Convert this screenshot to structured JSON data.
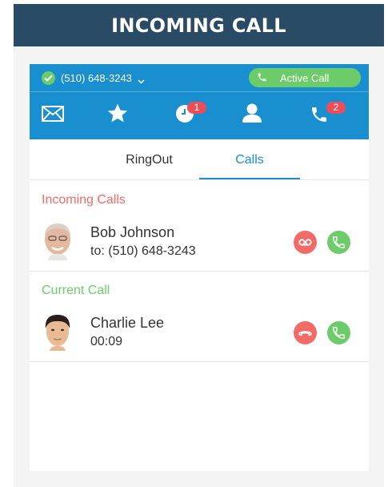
{
  "banner": {
    "title": "INCOMING CALL"
  },
  "topbar": {
    "phone_number": "(510) 648-3243",
    "active_call_label": "Active Call",
    "nav": [
      {
        "id": "messages",
        "icon": "envelope-icon",
        "badge": ""
      },
      {
        "id": "favorites",
        "icon": "star-icon",
        "badge": ""
      },
      {
        "id": "history",
        "icon": "clock-icon",
        "badge": "1"
      },
      {
        "id": "contacts",
        "icon": "person-icon",
        "badge": ""
      },
      {
        "id": "dialer",
        "icon": "phone-icon",
        "badge": "2"
      }
    ]
  },
  "tabs": {
    "ringout": "RingOut",
    "calls": "Calls",
    "active": "calls"
  },
  "incoming": {
    "title": "Incoming Calls",
    "name": "Bob Johnson",
    "detail": "to: (510) 648-3243"
  },
  "current": {
    "title": "Current Call",
    "name": "Charlie Lee",
    "detail": "00:09"
  },
  "colors": {
    "banner": "#2a4b66",
    "brand_blue": "#1a8fd0",
    "green": "#6ccc6a",
    "red": "#f36b67",
    "badge_red": "#ef4c57"
  }
}
